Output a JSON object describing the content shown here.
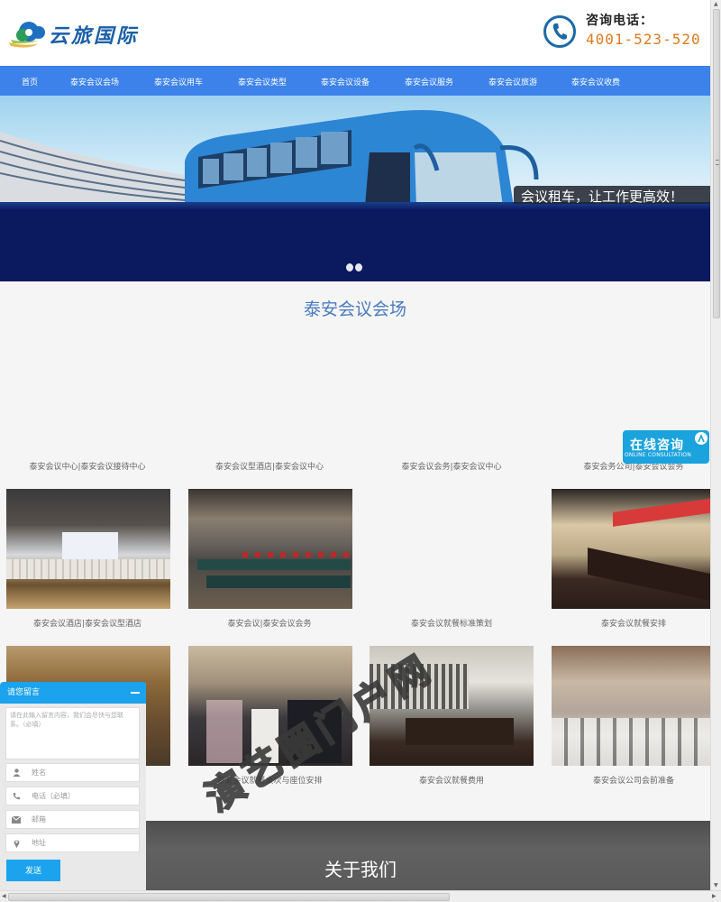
{
  "header": {
    "logo_text": "云旅国际",
    "hotline_label": "咨询电话：",
    "hotline_number": "4001-523-520"
  },
  "nav": {
    "items": [
      {
        "label": "首页"
      },
      {
        "label": "泰安会议会场"
      },
      {
        "label": "泰安会议用车"
      },
      {
        "label": "泰安会议类型"
      },
      {
        "label": "泰安会议设备"
      },
      {
        "label": "泰安会议服务"
      },
      {
        "label": "泰安会议旅游"
      },
      {
        "label": "泰安会议收费"
      }
    ],
    "background": "#3c82ea"
  },
  "banner": {
    "caption": "会议租车，让工作更高效！",
    "slide_count": 2,
    "active_slide": 1
  },
  "section": {
    "title": "泰安会议会场",
    "row1_captions": [
      "泰安会议中心|泰安会议接待中心",
      "泰安会议型酒店|泰安会议中心",
      "泰安会议会务|泰安会议中心",
      "泰安会务公司|泰安会议会务"
    ],
    "row2_captions": [
      "泰安会议酒店|泰安会议型酒店",
      "泰安会议|泰安会议会务",
      "泰安会议就餐标准策划",
      "泰安会议就餐安排"
    ],
    "row3_captions": [
      "",
      "泰安会议就餐桌次与座位安排",
      "泰安会议就餐费用",
      "泰安会议公司会前准备"
    ]
  },
  "consult_badge": {
    "main": "在线咨询",
    "sub": "ONLINE CONSULTATION"
  },
  "about": {
    "title": "关于我们"
  },
  "watermark": "演艺圈门户网",
  "message_widget": {
    "title": "请您留言",
    "textarea_placeholder": "请在此输入留言内容，我们会尽快与您联系。（必填）",
    "name_placeholder": "姓名",
    "phone_placeholder": "电话（必填）",
    "email_placeholder": "邮箱",
    "address_placeholder": "地址",
    "send_label": "发送"
  }
}
